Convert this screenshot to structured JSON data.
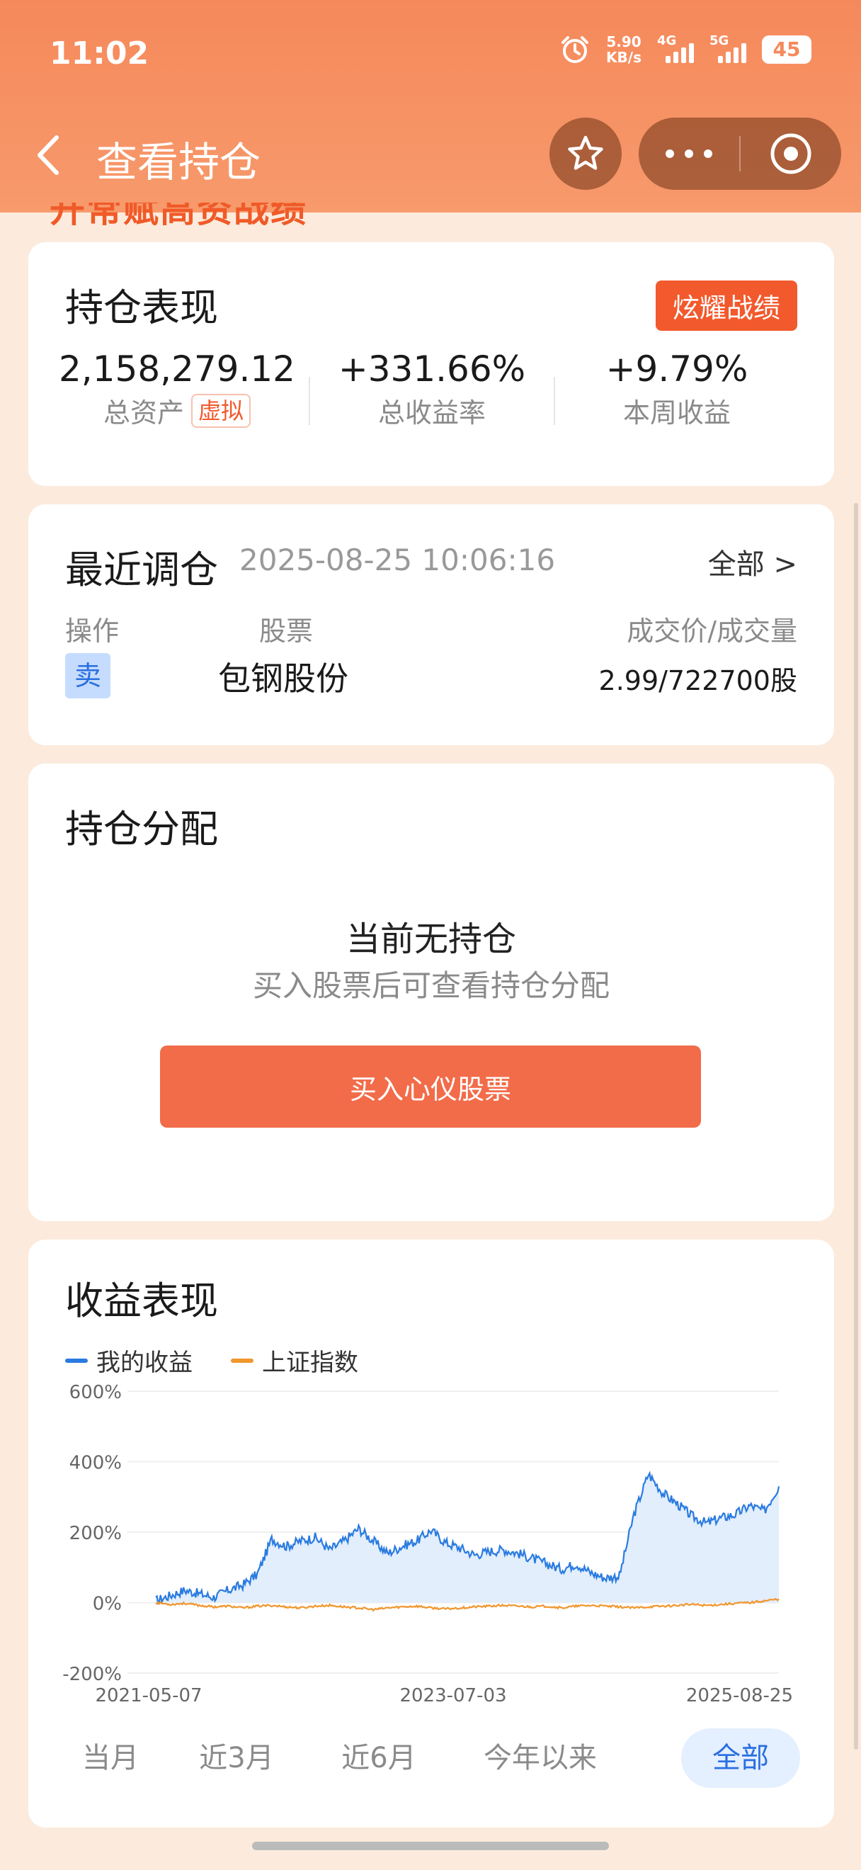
{
  "status_bar": {
    "time": "11:02",
    "speed_value": "5.90",
    "speed_unit": "KB/s",
    "net1": "4G",
    "net2": "5G",
    "battery": "45"
  },
  "nav": {
    "title": "查看持仓"
  },
  "banner_peek": "开常赋高资战绩",
  "performance": {
    "title": "持仓表现",
    "badge": "炫耀战绩",
    "total_assets": "2,158,279.12",
    "total_assets_label": "总资产",
    "virtual_tag": "虚拟",
    "total_return": "+331.66%",
    "total_return_label": "总收益率",
    "week_return": "+9.79%",
    "week_return_label": "本周收益"
  },
  "recent_trade": {
    "title": "最近调仓",
    "time": "2025-08-25 10:06:16",
    "all_link": "全部 >",
    "col_action": "操作",
    "col_stock": "股票",
    "col_price": "成交价/成交量",
    "action": "卖",
    "stock": "包钢股份",
    "deal": "2.99/722700股"
  },
  "allocation": {
    "title": "持仓分配",
    "empty_title": "当前无持仓",
    "empty_sub": "买入股票后可查看持仓分配",
    "buy_button": "买入心仪股票"
  },
  "earnings": {
    "title": "收益表现",
    "legend_mine": "我的收益",
    "legend_index": "上证指数",
    "tabs": [
      "当月",
      "近3月",
      "近6月",
      "今年以来",
      "全部"
    ],
    "active_tab": "全部"
  },
  "colors": {
    "accent": "#F2592C",
    "header": "#F5895B",
    "mine_line": "#2A7BE0",
    "index_line": "#F0962E"
  },
  "chart_data": {
    "type": "line",
    "x_ticks": [
      "2021-05-07",
      "2023-07-03",
      "2025-08-25"
    ],
    "y_ticks": [
      "600%",
      "400%",
      "200%",
      "0%",
      "-200%"
    ],
    "ylim": [
      -200,
      600
    ],
    "grid": true,
    "legend_position": "top-left",
    "series": [
      {
        "name": "我的收益",
        "values": [
          5,
          20,
          35,
          25,
          15,
          35,
          50,
          80,
          180,
          160,
          175,
          185,
          150,
          175,
          210,
          175,
          140,
          160,
          175,
          205,
          170,
          155,
          135,
          145,
          150,
          140,
          125,
          110,
          95,
          110,
          85,
          70,
          75,
          250,
          365,
          310,
          280,
          245,
          225,
          240,
          250,
          275,
          260,
          330
        ]
      },
      {
        "name": "上证指数",
        "values": [
          0,
          -5,
          -2,
          -8,
          -12,
          -10,
          -15,
          -10,
          -8,
          -12,
          -15,
          -10,
          -8,
          -12,
          -15,
          -20,
          -15,
          -12,
          -10,
          -15,
          -18,
          -15,
          -12,
          -10,
          -8,
          -10,
          -12,
          -10,
          -15,
          -10,
          -8,
          -10,
          -12,
          -15,
          -12,
          -10,
          -8,
          -5,
          -8,
          -5,
          -2,
          0,
          5,
          10
        ]
      }
    ]
  }
}
